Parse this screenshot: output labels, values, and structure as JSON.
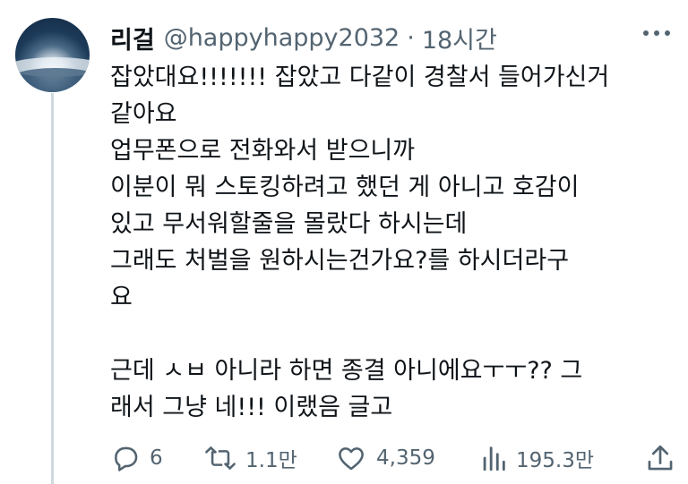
{
  "tweet": {
    "display_name": "리걸",
    "handle": "@happyhappy2032",
    "separator": "·",
    "time": "18시간",
    "body_lines": [
      "잡았대요!!!!!!! 잡았고 다같이 경찰서 들어가신거",
      "같아요",
      "업무폰으로 전화와서 받으니까",
      "이분이 뭐 스토킹하려고 했던 게 아니고 호감이",
      "있고 무서워할줄을 몰랐다 하시는데",
      "그래도 처벌을 원하시는건가요?를 하시더라구",
      "요",
      "",
      "근데 ㅅㅂ 아니라 하면 종결 아니에요ㅜㅜ?? 그",
      "래서 그냥 네!!! 이랬음 글고"
    ]
  },
  "actions": {
    "reply": {
      "icon": "reply-icon",
      "count": "6"
    },
    "retweet": {
      "icon": "retweet-icon",
      "count": "1.1만"
    },
    "like": {
      "icon": "heart-icon",
      "count": "4,359"
    },
    "views": {
      "icon": "views-icon",
      "count": "195.3만"
    },
    "share": {
      "icon": "share-icon"
    }
  },
  "colors": {
    "text": "#0f1419",
    "secondary": "#536471",
    "thread_line": "#cfd9de"
  }
}
